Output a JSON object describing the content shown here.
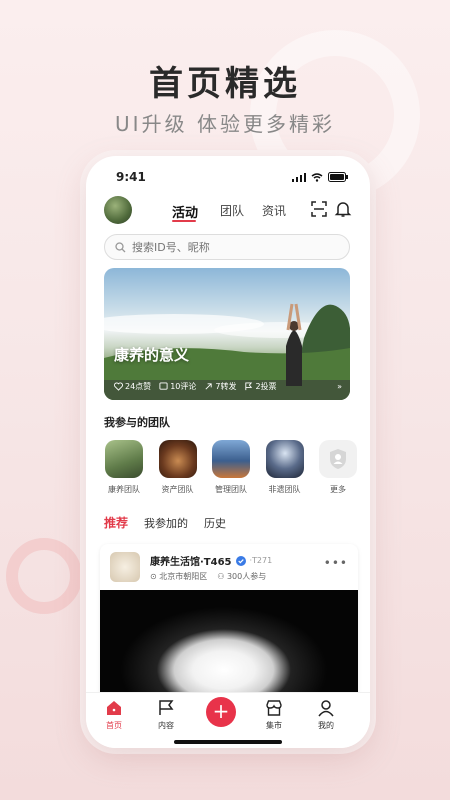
{
  "promo": {
    "title": "首页精选",
    "subtitle": "UI升级 体验更多精彩"
  },
  "status": {
    "time": "9:41"
  },
  "header": {
    "tabs": [
      "活动",
      "团队",
      "资讯"
    ],
    "active_tab": "活动"
  },
  "search": {
    "placeholder": "搜索ID号、昵称"
  },
  "banner": {
    "title": "康养的意义",
    "likes": "24点赞",
    "comments": "10评论",
    "shares": "7转发",
    "reports": "2投票"
  },
  "teams": {
    "title": "我参与的团队",
    "items": [
      {
        "label": "康养团队"
      },
      {
        "label": "资产团队"
      },
      {
        "label": "管理团队"
      },
      {
        "label": "非遗团队"
      },
      {
        "label": "更多"
      }
    ]
  },
  "subtabs": [
    "推荐",
    "我参加的",
    "历史"
  ],
  "card": {
    "name": "康养生活馆·T465",
    "tag": "·T271",
    "location": "北京市朝阳区",
    "participants": "300人参与",
    "more": "•••"
  },
  "nav": {
    "items": [
      {
        "label": "首页"
      },
      {
        "label": "内容"
      },
      {
        "label": "集市"
      },
      {
        "label": "我的"
      }
    ],
    "fab": "+"
  },
  "colors": {
    "accent": "#e23b4a",
    "fab": "#e8334a",
    "background": "#f7e7e7"
  }
}
